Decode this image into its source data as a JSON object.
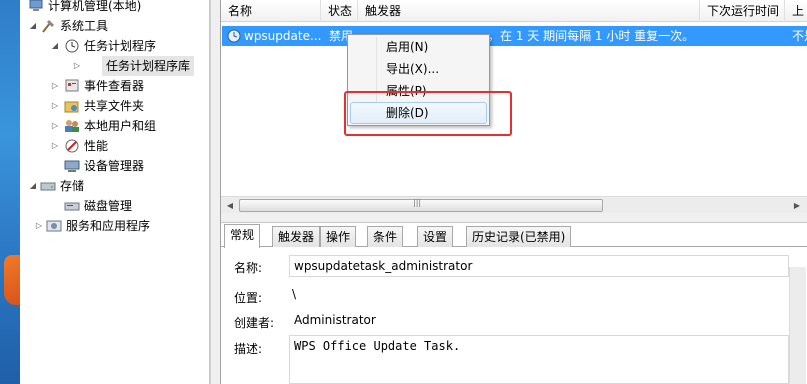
{
  "tree": {
    "items": [
      {
        "label": "计算机管理(本地)"
      },
      {
        "label": "系统工具"
      },
      {
        "label": "任务计划程序"
      },
      {
        "label": "任务计划程序库"
      },
      {
        "label": "事件查看器"
      },
      {
        "label": "共享文件夹"
      },
      {
        "label": "本地用户和组"
      },
      {
        "label": "性能"
      },
      {
        "label": "设备管理器"
      },
      {
        "label": "存储"
      },
      {
        "label": "磁盘管理"
      },
      {
        "label": "服务和应用程序"
      }
    ]
  },
  "columns": {
    "name": "名称",
    "status": "状态",
    "trigger": "触发器",
    "next_run": "下次运行时间",
    "last_partial": "上"
  },
  "task": {
    "name": "wpsupdate...",
    "status": "禁用",
    "trigger_tail": "，在 1 天 期间每隔 1 小时 重复一次。",
    "right_partial": "不是"
  },
  "context_menu": {
    "items": [
      {
        "label": "启用(N)"
      },
      {
        "label": "导出(X)..."
      },
      {
        "label": "属性(P)"
      },
      {
        "label": "删除(D)"
      }
    ]
  },
  "tabs": [
    {
      "label": "常规"
    },
    {
      "label": "触发器"
    },
    {
      "label": "操作"
    },
    {
      "label": "条件"
    },
    {
      "label": "设置"
    },
    {
      "label": "历史记录(已禁用)"
    }
  ],
  "general": {
    "name_label": "名称:",
    "name_value": "wpsupdatetask_administrator",
    "location_label": "位置:",
    "location_value": "\\",
    "author_label": "创建者:",
    "author_value": "Administrator",
    "desc_label": "描述:",
    "desc_value": "WPS Office Update Task."
  },
  "colors": {
    "selection": "#3399ff",
    "highlight_box": "#e33030"
  }
}
